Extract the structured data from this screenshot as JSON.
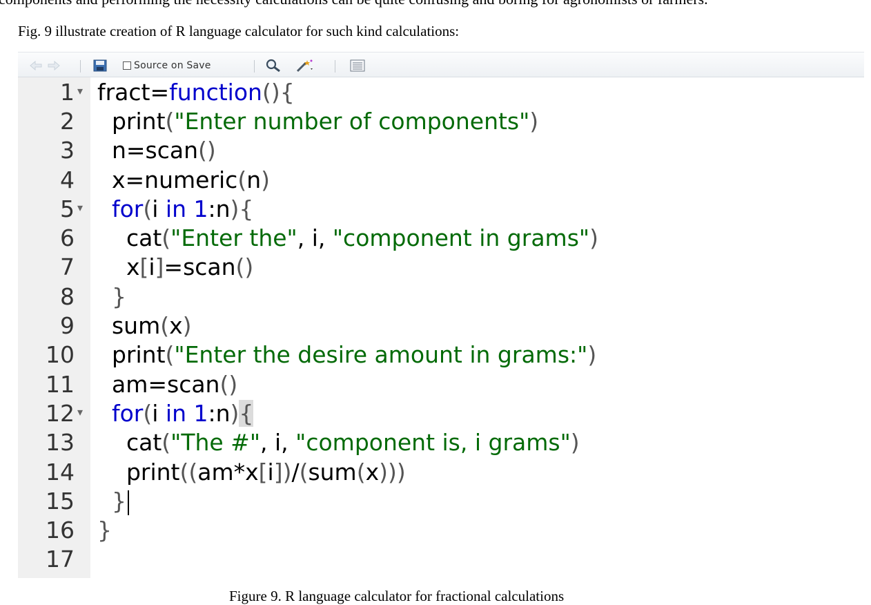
{
  "document": {
    "intro_text": "components and performing the necessity calculations can be quite confusing and boring for agronomists or farmers.",
    "fig_intro": "Fig. 9 illustrate creation of R language calculator for such kind calculations:",
    "caption": "Figure 9. R language calculator for fractional calculations"
  },
  "toolbar": {
    "source_on_save_label": "Source on Save",
    "source_on_save_checked": false,
    "icons": [
      "back-arrow-icon",
      "forward-arrow-icon",
      "save-icon",
      "search-icon",
      "wand-icon",
      "pages-icon"
    ]
  },
  "editor": {
    "line_numbers": [
      "1",
      "2",
      "3",
      "4",
      "5",
      "6",
      "7",
      "8",
      "9",
      "10",
      "11",
      "12",
      "13",
      "14",
      "15",
      "16",
      "17"
    ],
    "fold_markers": [
      "1",
      "5",
      "12"
    ],
    "lines": [
      "fract=function(){",
      "  print(\"Enter number of components\")",
      "  n=scan()",
      "  x=numeric(n)",
      "  for(i in 1:n){",
      "    cat(\"Enter the\", i, \"component in grams\")",
      "    x[i]=scan()",
      "  }",
      "  sum(x)",
      "  print(\"Enter the desire amount in grams:\")",
      "  am=scan()",
      "  for(i in 1:n){",
      "    cat(\"The #\", i, \"component is, i grams\")",
      "    print((am*x[i])/(sum(x)))",
      "  }",
      "}",
      ""
    ],
    "colors": {
      "keyword": "#0000cc",
      "string": "#036a07",
      "number": "#0000cd",
      "gutter_bg": "#f0f0f0"
    }
  }
}
